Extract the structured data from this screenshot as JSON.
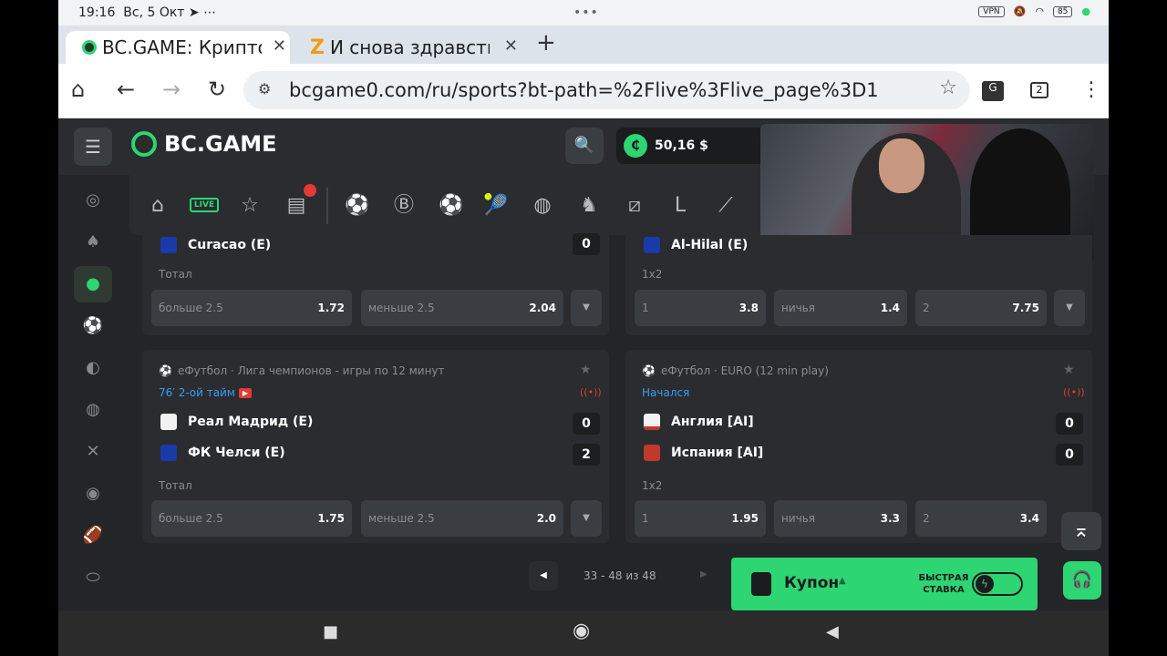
{
  "status": {
    "time": "19:16",
    "date": "Вс, 5 Окт",
    "more": "•••",
    "vpn": "VPN",
    "battery": "85"
  },
  "tabs": [
    {
      "title": "BC.GAME: Крипто",
      "close": "✕"
    },
    {
      "title": "И снова здравств",
      "close": "✕"
    }
  ],
  "new_tab": "+",
  "address": {
    "url": "bcgame0.com/ru/sports?bt-path=%2Flive%3Flive_page%3D1",
    "tab_count": "2"
  },
  "site": {
    "logo": "BC.GAME",
    "balance": "50,16 $",
    "live_label": "LIVE"
  },
  "cards": [
    {
      "team": "Curacao (E)",
      "score": "0",
      "market": "Тотал",
      "odds": [
        {
          "label": "больше 2.5",
          "value": "1.72"
        },
        {
          "label": "меньше 2.5",
          "value": "2.04"
        }
      ]
    },
    {
      "team": "Al-Hilal (E)",
      "market": "1x2",
      "odds": [
        {
          "label": "1",
          "value": "3.8"
        },
        {
          "label": "ничья",
          "value": "1.4"
        },
        {
          "label": "2",
          "value": "7.75"
        }
      ]
    },
    {
      "league": "еФутбол · Лига чемпионов - игры по 12 минут",
      "status": "76′ 2-ой тайм",
      "teams": [
        {
          "name": "Реал Мадрид (E)",
          "score": "0"
        },
        {
          "name": "ФК Челси (E)",
          "score": "2"
        }
      ],
      "market": "Тотал",
      "odds": [
        {
          "label": "больше 2.5",
          "value": "1.75"
        },
        {
          "label": "меньше 2.5",
          "value": "2.0"
        }
      ]
    },
    {
      "league": "еФутбол · EURO (12 min play)",
      "status": "Начался",
      "teams": [
        {
          "name": "Англия [AI]",
          "score": "0"
        },
        {
          "name": "Испания [AI]",
          "score": "0"
        }
      ],
      "market": "1x2",
      "odds": [
        {
          "label": "1",
          "value": "1.95"
        },
        {
          "label": "ничья",
          "value": "3.3"
        },
        {
          "label": "2",
          "value": "3.4"
        }
      ]
    }
  ],
  "pager": {
    "text": "33 - 48 из 48"
  },
  "coupon": {
    "label": "Купон",
    "fast_bet": "БЫСТРАЯ СТАВКА"
  },
  "colors": {
    "accent": "#2ed573",
    "bg": "#232528",
    "card": "#2a2c2f",
    "live_blue": "#3b9bf3",
    "live_red": "#e53935"
  }
}
